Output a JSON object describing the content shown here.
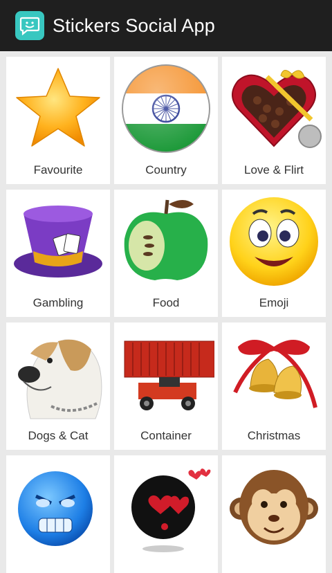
{
  "app": {
    "title": "Stickers Social App",
    "icon": "chat-bubble-smile-icon",
    "accent": "#38c7c0"
  },
  "categories": [
    {
      "label": "Favourite",
      "icon": "star-icon"
    },
    {
      "label": "Country",
      "icon": "india-flag-icon"
    },
    {
      "label": "Love & Flirt",
      "icon": "heart-gift-box-icon"
    },
    {
      "label": "Gambling",
      "icon": "magic-hat-cards-icon"
    },
    {
      "label": "Food",
      "icon": "green-apple-icon"
    },
    {
      "label": "Emoji",
      "icon": "smiley-face-icon"
    },
    {
      "label": "Dogs & Cat",
      "icon": "bulldog-icon"
    },
    {
      "label": "Container",
      "icon": "container-truck-icon"
    },
    {
      "label": "Christmas",
      "icon": "christmas-bells-icon"
    },
    {
      "label": "",
      "icon": "blue-face-icon"
    },
    {
      "label": "",
      "icon": "black-face-hearts-icon"
    },
    {
      "label": "",
      "icon": "monkey-face-icon"
    }
  ]
}
